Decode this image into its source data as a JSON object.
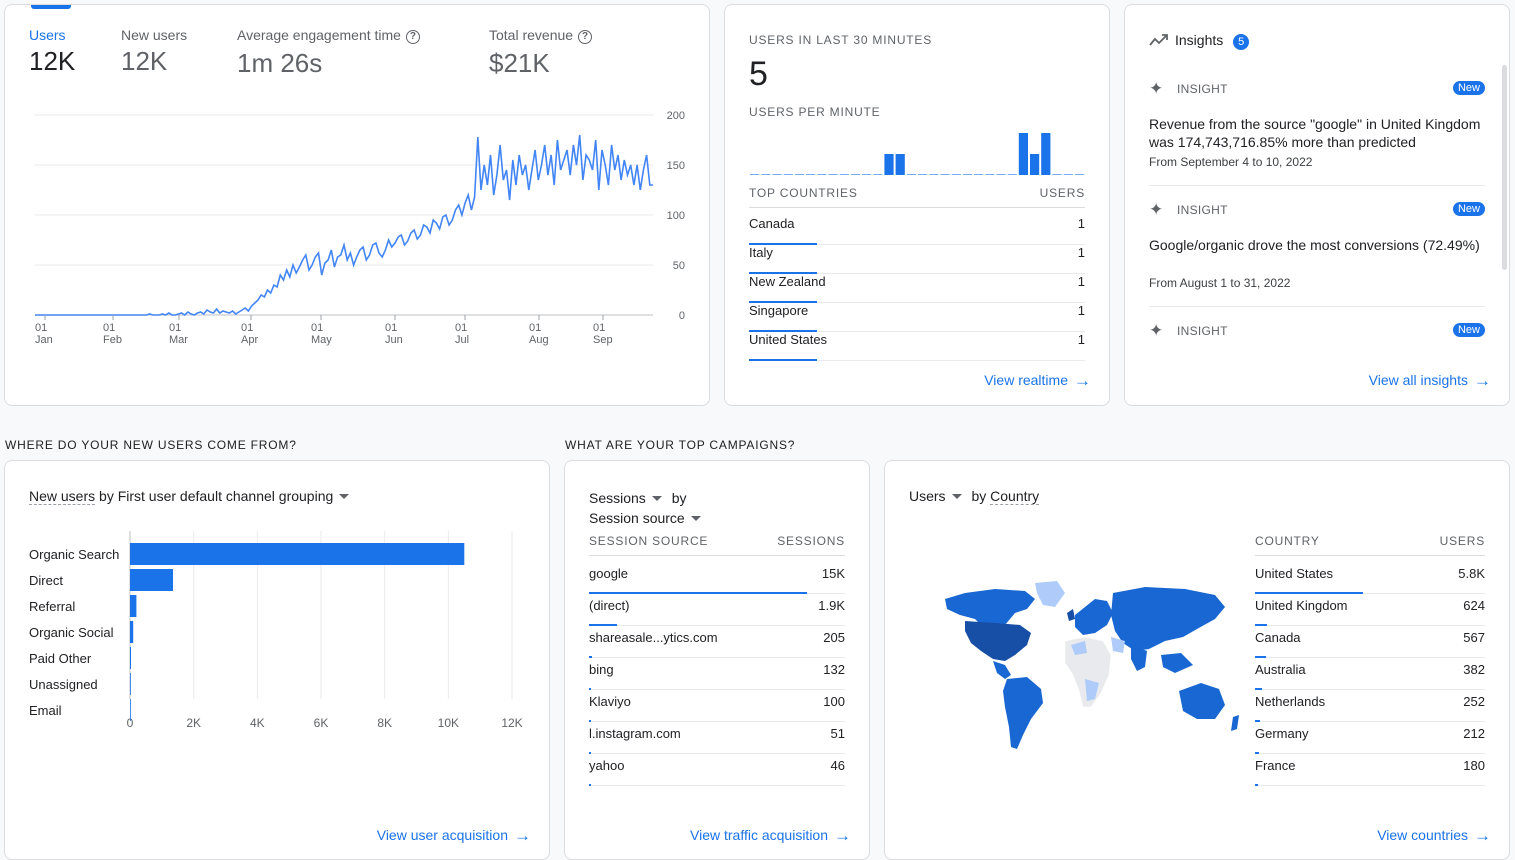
{
  "overview": {
    "kpis": [
      {
        "label": "Users",
        "value": "12K",
        "help": false
      },
      {
        "label": "New users",
        "value": "12K",
        "help": false
      },
      {
        "label": "Average engagement time",
        "value": "1m 26s",
        "help": true
      },
      {
        "label": "Total revenue",
        "value": "$21K",
        "help": true
      }
    ],
    "y_ticks": [
      "200",
      "150",
      "100",
      "50",
      "0"
    ],
    "x_ticks": [
      {
        "day": "01",
        "month": "Jan"
      },
      {
        "day": "01",
        "month": "Feb"
      },
      {
        "day": "01",
        "month": "Mar"
      },
      {
        "day": "01",
        "month": "Apr"
      },
      {
        "day": "01",
        "month": "May"
      },
      {
        "day": "01",
        "month": "Jun"
      },
      {
        "day": "01",
        "month": "Jul"
      },
      {
        "day": "01",
        "month": "Aug"
      },
      {
        "day": "01",
        "month": "Sep"
      }
    ]
  },
  "realtime": {
    "title": "USERS IN LAST 30 MINUTES",
    "value": "5",
    "per_minute_title": "USERS PER MINUTE",
    "per_minute": [
      0,
      0,
      0,
      0,
      0,
      0,
      0,
      0,
      0,
      0,
      0,
      0,
      1,
      1,
      0,
      0,
      0,
      0,
      0,
      0,
      0,
      0,
      0,
      0,
      2,
      1,
      2,
      0,
      0,
      0
    ],
    "countries_header": "TOP COUNTRIES",
    "users_header": "USERS",
    "countries": [
      {
        "name": "Canada",
        "value": "1"
      },
      {
        "name": "Italy",
        "value": "1"
      },
      {
        "name": "New Zealand",
        "value": "1"
      },
      {
        "name": "Singapore",
        "value": "1"
      },
      {
        "name": "United States",
        "value": "1"
      }
    ],
    "link": "View realtime"
  },
  "insights": {
    "title": "Insights",
    "count": "5",
    "items": [
      {
        "tag": "INSIGHT",
        "badge": "New",
        "text_parts": [
          "Revenue from the source \"google\" in United Kingdom was 174,743,716.85% more than predicted"
        ],
        "date": "From September 4 to 10, 2022"
      },
      {
        "tag": "INSIGHT",
        "badge": "New",
        "text_parts": [
          "Google/organic drove the most conversions (72.49%)"
        ],
        "date": "From August 1 to 31, 2022"
      },
      {
        "tag": "INSIGHT",
        "badge": "New",
        "text_parts": [
          ""
        ],
        "date": ""
      }
    ],
    "link": "View all insights"
  },
  "section_titles": {
    "acquisition": "WHERE DO YOUR NEW USERS COME FROM?",
    "campaigns": "WHAT ARE YOUR TOP CAMPAIGNS?"
  },
  "acquisition": {
    "title_metric": "New users",
    "title_rest": " by First user default channel grouping",
    "link": "View user acquisition"
  },
  "campaigns": {
    "metric": "Sessions",
    "by": "by",
    "dimension": "Session source",
    "col_source": "SESSION SOURCE",
    "col_sessions": "SESSIONS",
    "rows": [
      {
        "name": "google",
        "value": "15K",
        "frac": 1.0
      },
      {
        "name": "(direct)",
        "value": "1.9K",
        "frac": 0.126
      },
      {
        "name": "shareasale...ytics.com",
        "value": "205",
        "frac": 0.014
      },
      {
        "name": "bing",
        "value": "132",
        "frac": 0.009
      },
      {
        "name": "Klaviyo",
        "value": "100",
        "frac": 0.007
      },
      {
        "name": "l.instagram.com",
        "value": "51",
        "frac": 0.003
      },
      {
        "name": "yahoo",
        "value": "46",
        "frac": 0.003
      }
    ],
    "link": "View traffic acquisition"
  },
  "countries": {
    "metric": "Users",
    "by": "by",
    "dimension": "Country",
    "col_country": "COUNTRY",
    "col_users": "USERS",
    "rows": [
      {
        "name": "United States",
        "value": "5.8K",
        "frac": 1.0
      },
      {
        "name": "United Kingdom",
        "value": "624",
        "frac": 0.108
      },
      {
        "name": "Canada",
        "value": "567",
        "frac": 0.098
      },
      {
        "name": "Australia",
        "value": "382",
        "frac": 0.066
      },
      {
        "name": "Netherlands",
        "value": "252",
        "frac": 0.043
      },
      {
        "name": "Germany",
        "value": "212",
        "frac": 0.037
      },
      {
        "name": "France",
        "value": "180",
        "frac": 0.031
      }
    ],
    "link": "View countries"
  },
  "chart_data": [
    {
      "type": "line",
      "series": [
        {
          "name": "Users",
          "values": [
            0,
            0,
            0,
            0,
            0,
            0,
            0,
            0,
            0,
            0,
            0,
            0,
            0,
            0,
            0,
            0,
            0,
            0,
            0,
            0,
            0,
            0,
            0,
            0,
            0,
            0,
            0,
            0,
            0,
            0,
            0,
            0,
            0,
            0,
            0,
            0,
            1,
            0,
            0,
            0,
            1,
            0,
            2,
            0,
            0,
            1,
            2,
            0,
            3,
            1,
            0,
            2,
            3,
            1,
            5,
            3,
            2,
            6,
            2,
            4,
            3,
            2,
            4,
            1,
            3,
            5,
            7,
            4,
            9,
            12,
            15,
            20,
            18,
            25,
            22,
            30,
            28,
            40,
            35,
            45,
            38,
            50,
            42,
            48,
            55,
            60,
            45,
            50,
            58,
            62,
            40,
            52,
            55,
            65,
            48,
            58,
            60,
            70,
            55,
            62,
            50,
            58,
            65,
            68,
            55,
            60,
            70,
            72,
            62,
            58,
            65,
            75,
            68,
            72,
            78,
            80,
            70,
            74,
            82,
            85,
            76,
            80,
            90,
            88,
            82,
            95,
            92,
            86,
            98,
            100,
            90,
            95,
            105,
            110,
            100,
            112,
            120,
            105,
            118,
            178,
            125,
            150,
            130,
            160,
            120,
            140,
            170,
            135,
            145,
            115,
            155,
            130,
            160,
            140,
            150,
            125,
            145,
            165,
            135,
            150,
            170,
            140,
            160,
            130,
            175,
            145,
            155,
            165,
            140,
            170,
            150,
            180,
            135,
            160,
            155,
            145,
            175,
            125,
            165,
            150,
            130,
            170,
            145,
            160,
            135,
            155,
            140,
            150,
            130,
            150,
            125,
            145,
            160,
            130,
            130
          ]
        }
      ],
      "ylim": [
        0,
        200
      ],
      "y_ticks": [
        0,
        50,
        100,
        150,
        200
      ],
      "x_tick_labels": [
        "01 Jan",
        "01 Feb",
        "01 Mar",
        "01 Apr",
        "01 May",
        "01 Jun",
        "01 Jul",
        "01 Aug",
        "01 Sep"
      ]
    },
    {
      "type": "bar",
      "orientation": "horizontal",
      "categories": [
        "Organic Search",
        "Direct",
        "Referral",
        "Organic Social",
        "Paid Other",
        "Unassigned",
        "Email"
      ],
      "values": [
        10500,
        1350,
        200,
        100,
        30,
        5,
        2
      ],
      "xlim": [
        0,
        12000
      ],
      "x_ticks": [
        "0",
        "2K",
        "4K",
        "6K",
        "8K",
        "10K",
        "12K"
      ]
    }
  ],
  "colors": {
    "accent": "#1a73e8",
    "map_dark": "#174ea6",
    "map_mid": "#1967d2",
    "map_light": "#aecbfa",
    "map_none": "#e8eaed"
  }
}
